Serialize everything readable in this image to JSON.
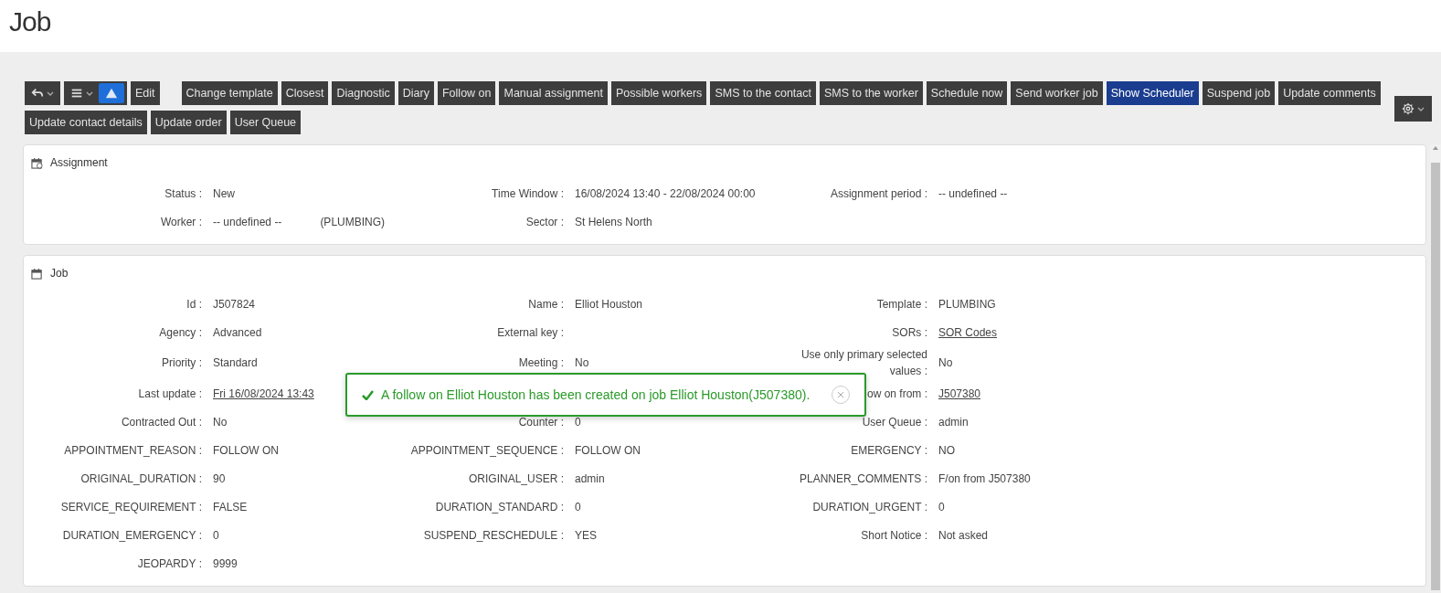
{
  "page_title": "Job",
  "toolbar": {
    "icon_groups": [
      {
        "items": [
          {
            "kind": "undo",
            "caret": true,
            "selected": false
          }
        ]
      },
      {
        "items": [
          {
            "kind": "menu",
            "caret": true,
            "selected": false
          },
          {
            "kind": "alert",
            "caret": false,
            "selected": true
          }
        ]
      }
    ],
    "edit_button": "Edit",
    "buttons": [
      {
        "label": "Change template",
        "selected": false
      },
      {
        "label": "Closest",
        "selected": false
      },
      {
        "label": "Diagnostic",
        "selected": false
      },
      {
        "label": "Diary",
        "selected": false
      },
      {
        "label": "Follow on",
        "selected": false
      },
      {
        "label": "Manual assignment",
        "selected": false
      },
      {
        "label": "Possible workers",
        "selected": false
      },
      {
        "label": "SMS to the contact",
        "selected": false
      },
      {
        "label": "SMS to the worker",
        "selected": false
      },
      {
        "label": "Schedule now",
        "selected": false
      },
      {
        "label": "Send worker job",
        "selected": false
      },
      {
        "label": "Show Scheduler",
        "selected": true
      },
      {
        "label": "Suspend job",
        "selected": false
      },
      {
        "label": "Update comments",
        "selected": false
      },
      {
        "label": "Update contact details",
        "selected": false
      },
      {
        "label": "Update order",
        "selected": false
      },
      {
        "label": "User Queue",
        "selected": false
      }
    ],
    "settings": {
      "kind": "settings",
      "caret": true
    }
  },
  "sections": [
    {
      "title": "Assignment",
      "rows": [
        {
          "left": {
            "label": "Status :",
            "value": "New"
          },
          "middle": {
            "label": "Time Window :",
            "value": "16/08/2024 13:40 - 22/08/2024 00:00"
          },
          "right": {
            "label": "Assignment period :",
            "value": "-- undefined --"
          }
        },
        {
          "left": {
            "label": "Worker :",
            "value": "-- undefined --",
            "extra": "(PLUMBING)"
          },
          "middle": {
            "label": "Sector :",
            "value": "St Helens North"
          }
        }
      ]
    },
    {
      "title": "Job",
      "rows": [
        {
          "left": {
            "label": "Id :",
            "value": "J507824"
          },
          "middle": {
            "label": "Name :",
            "value": "Elliot Houston"
          },
          "right": {
            "label": "Template :",
            "value": "PLUMBING"
          }
        },
        {
          "left": {
            "label": "Agency :",
            "value": "Advanced"
          },
          "middle": {
            "label": "External key :"
          },
          "right": {
            "label": "SORs :",
            "value": "SOR Codes",
            "link": true
          }
        },
        {
          "left": {
            "label": "Priority :",
            "value": "Standard"
          },
          "middle": {
            "label": "Meeting :",
            "value": "No"
          },
          "right": {
            "label": "Use only primary selected values :",
            "value": "No"
          }
        },
        {
          "left": {
            "label": "Last update :",
            "value": "Fri 16/08/2024 13:43",
            "link": true
          },
          "right": {
            "label": "ow on from :",
            "value": "J507380",
            "link": true
          }
        },
        {
          "left": {
            "label": "Contracted Out :",
            "value": "No"
          },
          "middle": {
            "label": "Counter :",
            "value": "0"
          },
          "right": {
            "label": "User Queue :",
            "value": "admin"
          }
        },
        {
          "left": {
            "label": "APPOINTMENT_REASON :",
            "value": "FOLLOW ON"
          },
          "middle": {
            "label": "APPOINTMENT_SEQUENCE :",
            "value": "FOLLOW ON"
          },
          "right": {
            "label": "EMERGENCY :",
            "value": "NO"
          }
        },
        {
          "left": {
            "label": "ORIGINAL_DURATION :",
            "value": "90"
          },
          "middle": {
            "label": "ORIGINAL_USER :",
            "value": "admin"
          },
          "right": {
            "label": "PLANNER_COMMENTS :",
            "value": "F/on from J507380"
          }
        },
        {
          "left": {
            "label": "SERVICE_REQUIREMENT :",
            "value": "FALSE"
          },
          "middle": {
            "label": "DURATION_STANDARD :",
            "value": "0"
          },
          "right": {
            "label": "DURATION_URGENT :",
            "value": "0"
          }
        },
        {
          "left": {
            "label": "DURATION_EMERGENCY :",
            "value": "0"
          },
          "middle": {
            "label": "SUSPEND_RESCHEDULE :",
            "value": "YES"
          },
          "right": {
            "label": "Short Notice :",
            "value": "Not asked"
          }
        },
        {
          "left": {
            "label": "JEOPARDY :",
            "value": "9999"
          }
        }
      ],
      "toast": {
        "kind": "success",
        "message": "A follow on Elliot Houston has been created on job Elliot Houston(J507380)."
      }
    }
  ]
}
